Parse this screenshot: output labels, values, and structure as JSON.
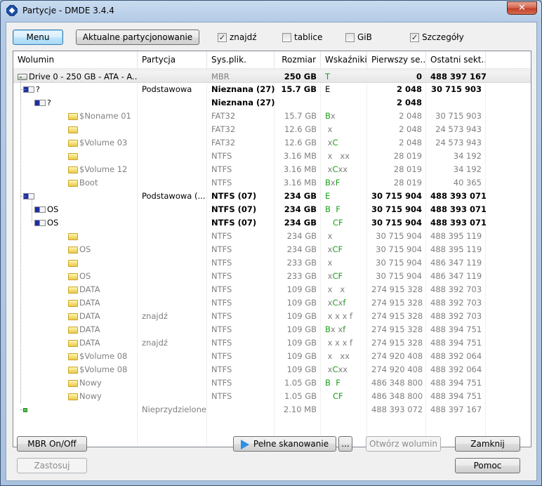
{
  "window": {
    "title": "Partycje - DMDE 3.4.4",
    "close_label": "✕"
  },
  "toolbar": {
    "menu_label": "Menu",
    "current_partitioning_label": "Aktualne partycjonowanie",
    "checkboxes": [
      {
        "label": "znajdź",
        "checked": true
      },
      {
        "label": "tablice",
        "checked": false
      },
      {
        "label": "GiB",
        "checked": false
      },
      {
        "label": "Szczegóły",
        "checked": true
      }
    ]
  },
  "table": {
    "columns": [
      "Wolumin",
      "Partycja",
      "Sys.plik.",
      "Rozmiar",
      "Wskaźniki",
      "Pierwszy se...",
      "Ostatni sekt..."
    ],
    "rows": [
      {
        "indent": 0,
        "icon": "disk",
        "name": "Drive 0 - 250 GB - ATA - A...",
        "part": "",
        "fs": "MBR",
        "size": "250 GB",
        "flags": [
          {
            "t": "T",
            "g": true
          }
        ],
        "first": "0",
        "last": "488 397 167",
        "style": "bold-size",
        "selected": true
      },
      {
        "indent": 1,
        "icon": "partblue-q",
        "name": "",
        "part": "Podstawowa",
        "fs": "Nieznana (27)",
        "size": "15.7 GB",
        "flags": [
          {
            "t": "E",
            "g": false
          }
        ],
        "first": "2 048",
        "last": "30 715 903",
        "style": "bold"
      },
      {
        "indent": 2,
        "icon": "partblue-q",
        "name": "",
        "part": "",
        "fs": "Nieznana (27)",
        "size": "",
        "flags": [],
        "first": "2 048",
        "last": "",
        "style": "bold"
      },
      {
        "indent": 3,
        "icon": "folder",
        "name": "$Noname 01",
        "part": "",
        "fs": "FAT32",
        "size": "15.7 GB",
        "flags": [
          {
            "t": "B",
            "g": true
          },
          {
            "t": "x",
            "g": false
          }
        ],
        "first": "2 048",
        "last": "30 715 903",
        "style": "gray"
      },
      {
        "indent": 3,
        "icon": "folder",
        "name": "",
        "part": "",
        "fs": "FAT32",
        "size": "12.6 GB",
        "flags": [
          {
            "t": " x",
            "g": false
          }
        ],
        "first": "2 048",
        "last": "24 573 943",
        "style": "gray"
      },
      {
        "indent": 3,
        "icon": "folder",
        "name": "$Volume 03",
        "part": "",
        "fs": "FAT32",
        "size": "12.6 GB",
        "flags": [
          {
            "t": " x",
            "g": false
          },
          {
            "t": "C",
            "g": true
          }
        ],
        "first": "2 048",
        "last": "24 573 943",
        "style": "gray"
      },
      {
        "indent": 3,
        "icon": "folder",
        "name": "",
        "part": "",
        "fs": "NTFS",
        "size": "3.16 MB",
        "flags": [
          {
            "t": " x   xx",
            "g": false
          }
        ],
        "first": "28 019",
        "last": "34 192",
        "style": "gray"
      },
      {
        "indent": 3,
        "icon": "folder",
        "name": "$Volume 12",
        "part": "",
        "fs": "NTFS",
        "size": "3.16 MB",
        "flags": [
          {
            "t": " x",
            "g": false
          },
          {
            "t": "C",
            "g": true
          },
          {
            "t": "xx",
            "g": false
          }
        ],
        "first": "28 019",
        "last": "34 192",
        "style": "gray"
      },
      {
        "indent": 3,
        "icon": "folder",
        "name": "Boot",
        "part": "",
        "fs": "NTFS",
        "size": "3.16 MB",
        "flags": [
          {
            "t": "B",
            "g": true
          },
          {
            "t": "x",
            "g": false
          },
          {
            "t": "F",
            "g": true
          }
        ],
        "first": "28 019",
        "last": "40 365",
        "style": "gray"
      },
      {
        "indent": 1,
        "icon": "partblue",
        "name": "",
        "part": "Podstawowa (...",
        "fs": "NTFS (07)",
        "size": "234 GB",
        "flags": [
          {
            "t": "E",
            "g": true
          }
        ],
        "first": "30 715 904",
        "last": "488 393 071",
        "style": "bold"
      },
      {
        "indent": 2,
        "icon": "partblue",
        "name": "OS",
        "part": "",
        "fs": "NTFS (07)",
        "size": "234 GB",
        "flags": [
          {
            "t": "B",
            "g": true
          },
          {
            "t": "  ",
            "g": false
          },
          {
            "t": "F",
            "g": true
          }
        ],
        "first": "30 715 904",
        "last": "488 393 071",
        "style": "bold"
      },
      {
        "indent": 2,
        "icon": "partblue",
        "name": "OS",
        "part": "",
        "fs": "NTFS (07)",
        "size": "234 GB",
        "flags": [
          {
            "t": "   C",
            "g": true
          },
          {
            "t": "F",
            "g": true
          }
        ],
        "first": "30 715 904",
        "last": "488 393 071",
        "style": "bold"
      },
      {
        "indent": 3,
        "icon": "folder",
        "name": "",
        "part": "",
        "fs": "NTFS",
        "size": "234 GB",
        "flags": [
          {
            "t": " x",
            "g": false
          }
        ],
        "first": "30 715 904",
        "last": "488 395 119",
        "style": "gray"
      },
      {
        "indent": 3,
        "icon": "folder",
        "name": "OS",
        "part": "",
        "fs": "NTFS",
        "size": "234 GB",
        "flags": [
          {
            "t": " x",
            "g": false
          },
          {
            "t": "C",
            "g": true
          },
          {
            "t": "F",
            "g": true
          }
        ],
        "first": "30 715 904",
        "last": "488 395 119",
        "style": "gray"
      },
      {
        "indent": 3,
        "icon": "folder",
        "name": "",
        "part": "",
        "fs": "NTFS",
        "size": "233 GB",
        "flags": [
          {
            "t": " x",
            "g": false
          }
        ],
        "first": "30 715 904",
        "last": "486 347 119",
        "style": "gray"
      },
      {
        "indent": 3,
        "icon": "folder",
        "name": "OS",
        "part": "",
        "fs": "NTFS",
        "size": "233 GB",
        "flags": [
          {
            "t": " x",
            "g": false
          },
          {
            "t": "C",
            "g": true
          },
          {
            "t": "F",
            "g": true
          }
        ],
        "first": "30 715 904",
        "last": "486 347 119",
        "style": "gray"
      },
      {
        "indent": 3,
        "icon": "folder",
        "name": "DATA",
        "part": "",
        "fs": "NTFS",
        "size": "109 GB",
        "flags": [
          {
            "t": " x   x",
            "g": false
          }
        ],
        "first": "274 915 328",
        "last": "488 392 703",
        "style": "gray"
      },
      {
        "indent": 3,
        "icon": "folder",
        "name": "DATA",
        "part": "",
        "fs": "NTFS",
        "size": "109 GB",
        "flags": [
          {
            "t": " x",
            "g": false
          },
          {
            "t": "C",
            "g": true
          },
          {
            "t": "x",
            "g": false
          },
          {
            "t": "f",
            "g": true
          }
        ],
        "first": "274 915 328",
        "last": "488 392 703",
        "style": "gray"
      },
      {
        "indent": 3,
        "icon": "folder",
        "name": "DATA",
        "part": "znajdź",
        "fs": "NTFS",
        "size": "109 GB",
        "flags": [
          {
            "t": " x x x f",
            "g": false
          }
        ],
        "first": "274 915 328",
        "last": "488 392 703",
        "style": "gray"
      },
      {
        "indent": 3,
        "icon": "folder",
        "name": "DATA",
        "part": "",
        "fs": "NTFS",
        "size": "109 GB",
        "flags": [
          {
            "t": "B",
            "g": true
          },
          {
            "t": "x x",
            "g": false
          },
          {
            "t": "f",
            "g": true
          }
        ],
        "first": "274 915 328",
        "last": "488 394 751",
        "style": "gray"
      },
      {
        "indent": 3,
        "icon": "folder",
        "name": "DATA",
        "part": "znajdź",
        "fs": "NTFS",
        "size": "109 GB",
        "flags": [
          {
            "t": " x x x f",
            "g": false
          }
        ],
        "first": "274 915 328",
        "last": "488 394 751",
        "style": "gray"
      },
      {
        "indent": 3,
        "icon": "folder",
        "name": "$Volume 08",
        "part": "",
        "fs": "NTFS",
        "size": "109 GB",
        "flags": [
          {
            "t": " x   xx",
            "g": false
          }
        ],
        "first": "274 920 408",
        "last": "488 392 064",
        "style": "gray"
      },
      {
        "indent": 3,
        "icon": "folder",
        "name": "$Volume 08",
        "part": "",
        "fs": "NTFS",
        "size": "109 GB",
        "flags": [
          {
            "t": " x",
            "g": false
          },
          {
            "t": "C",
            "g": true
          },
          {
            "t": "xx",
            "g": false
          }
        ],
        "first": "274 920 408",
        "last": "488 392 064",
        "style": "gray"
      },
      {
        "indent": 3,
        "icon": "folder",
        "name": "Nowy",
        "part": "",
        "fs": "NTFS",
        "size": "1.05 GB",
        "flags": [
          {
            "t": "B",
            "g": true
          },
          {
            "t": "  ",
            "g": false
          },
          {
            "t": "F",
            "g": true
          }
        ],
        "first": "486 348 800",
        "last": "488 394 751",
        "style": "gray"
      },
      {
        "indent": 3,
        "icon": "folder",
        "name": "Nowy",
        "part": "",
        "fs": "NTFS",
        "size": "1.05 GB",
        "flags": [
          {
            "t": "   C",
            "g": true
          },
          {
            "t": "F",
            "g": true
          }
        ],
        "first": "486 348 800",
        "last": "488 394 751",
        "style": "gray"
      },
      {
        "indent": 1,
        "icon": "free",
        "name": "",
        "part": "Nieprzydzielone",
        "fs": "",
        "size": "2.10 MB",
        "flags": [],
        "first": "488 393 072",
        "last": "488 397 167",
        "style": "gray"
      }
    ]
  },
  "footer": {
    "mbr_onoff_label": "MBR On/Off",
    "apply_label": "Zastosuj",
    "full_scan_label": "Pełne skanowanie",
    "more_label": "...",
    "open_volume_label": "Otwórz wolumin",
    "close_label": "Zamknij",
    "help_label": "Pomoc"
  },
  "colors": {
    "flag_green": "#1aa01a",
    "gray_text": "#808080",
    "titlebar": "#b4cbe6"
  }
}
